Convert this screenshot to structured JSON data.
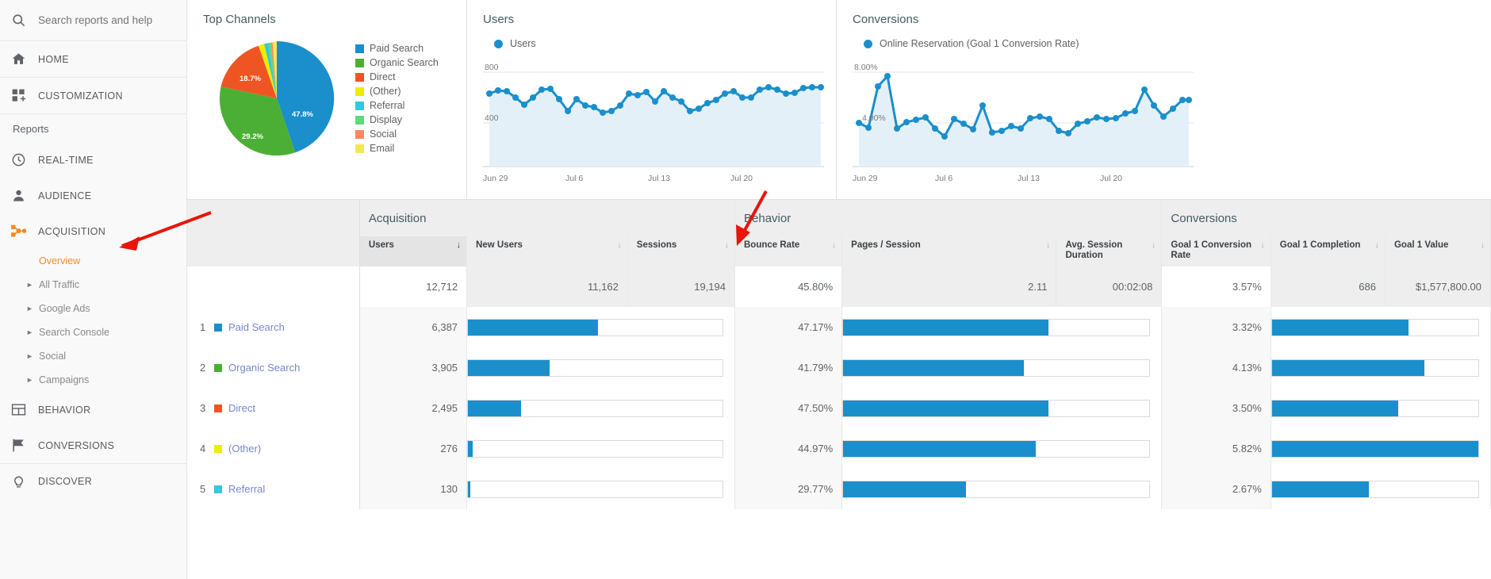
{
  "sidebar": {
    "search": {
      "placeholder": "Search reports and help",
      "icon": "search-icon"
    },
    "home": {
      "label": "HOME",
      "icon": "home-icon"
    },
    "customization": {
      "label": "CUSTOMIZATION",
      "icon": "customization-icon"
    },
    "reports_label": "Reports",
    "items": [
      {
        "label": "REAL-TIME",
        "icon": "clock-icon"
      },
      {
        "label": "AUDIENCE",
        "icon": "person-icon"
      },
      {
        "label": "ACQUISITION",
        "icon": "acquisition-icon"
      },
      {
        "label": "BEHAVIOR",
        "icon": "behavior-icon"
      },
      {
        "label": "CONVERSIONS",
        "icon": "flag-icon"
      },
      {
        "label": "DISCOVER",
        "icon": "lightbulb-icon"
      }
    ],
    "acquisition_sub": [
      {
        "label": "Overview",
        "selected": true
      },
      {
        "label": "All Traffic",
        "selected": false
      },
      {
        "label": "Google Ads",
        "selected": false
      },
      {
        "label": "Search Console",
        "selected": false
      },
      {
        "label": "Social",
        "selected": false
      },
      {
        "label": "Campaigns",
        "selected": false
      }
    ]
  },
  "cards": {
    "pie_title": "Top Channels",
    "users_title": "Users",
    "conversions_title": "Conversions",
    "users_legend": "Users",
    "conversions_legend": "Online Reservation (Goal 1 Conversion Rate)"
  },
  "chart_data": [
    {
      "type": "pie",
      "title": "Top Channels",
      "legend_position": "right",
      "labels": [
        "Paid Search",
        "Organic Search",
        "Direct",
        "(Other)",
        "Referral",
        "Display",
        "Social",
        "Email"
      ],
      "values": [
        47.8,
        29.2,
        18.7,
        1.6,
        1.1,
        0.7,
        0.5,
        0.4
      ],
      "shown_labels": [
        "47.8%",
        "29.2%",
        "18.7%"
      ],
      "colors": [
        "#1a8fcb",
        "#4caf35",
        "#ef5522",
        "#eded00",
        "#36c6e0",
        "#5fd97a",
        "#f98862",
        "#f3e757"
      ]
    },
    {
      "type": "area",
      "title": "Users",
      "series_name": "Users",
      "ylabel": "",
      "xlabel": "",
      "ylim": [
        0,
        1000
      ],
      "yticks": [
        "800",
        "400"
      ],
      "xticks": [
        "Jun 29",
        "Jul 6",
        "Jul 13",
        "Jul 20"
      ],
      "grid": true,
      "values": [
        620,
        640,
        638,
        608,
        572,
        608,
        648,
        650,
        600,
        540,
        600,
        568,
        560,
        530,
        540,
        568,
        620,
        612,
        628,
        578,
        632,
        600,
        578,
        540,
        552,
        580,
        598,
        628,
        640,
        608,
        608,
        648,
        660,
        648,
        628,
        634,
        658,
        660
      ]
    },
    {
      "type": "area",
      "title": "Conversions",
      "series_name": "Online Reservation (Goal 1 Conversion Rate)",
      "ylabel": "",
      "xlabel": "",
      "ylim": [
        0,
        10
      ],
      "yticks": [
        "8.00%",
        "4.00%"
      ],
      "xticks": [
        "Jun 29",
        "Jul 6",
        "Jul 13",
        "Jul 20"
      ],
      "grid": true,
      "values": [
        4.0,
        3.65,
        6.9,
        7.75,
        3.6,
        4.1,
        4.25,
        4.45,
        3.6,
        2.9,
        4.3,
        3.9,
        3.55,
        5.0,
        3.35,
        3.45,
        3.75,
        3.6,
        4.35,
        4.5,
        4.3,
        3.5,
        3.3,
        3.9,
        4.1,
        4.4,
        4.25,
        4.35,
        4.7,
        4.9,
        6.6,
        5.0,
        4.4,
        5.1,
        5.8
      ]
    }
  ],
  "table": {
    "groups": [
      {
        "label": "Acquisition",
        "span": 3
      },
      {
        "label": "Behavior",
        "span": 3
      },
      {
        "label": "Conversions",
        "span": 3
      }
    ],
    "columns": [
      {
        "label": "Users",
        "sorted": true
      },
      {
        "label": "New Users",
        "sorted": false
      },
      {
        "label": "Sessions",
        "sorted": false
      },
      {
        "label": "Bounce Rate",
        "sorted": false
      },
      {
        "label": "Pages / Session",
        "sorted": false
      },
      {
        "label": "Avg. Session Duration",
        "sorted": false
      },
      {
        "label": "Goal 1 Conversion Rate",
        "sorted": false
      },
      {
        "label": "Goal 1 Completion",
        "sorted": false
      },
      {
        "label": "Goal 1 Value",
        "sorted": false
      }
    ],
    "totals": {
      "users": "12,712",
      "new_users": "11,162",
      "sessions": "19,194",
      "bounce_rate": "45.80%",
      "pages_session": "2.11",
      "avg_duration": "00:02:08",
      "goal1_rate": "3.57%",
      "goal1_completion": "686",
      "goal1_value": "$1,577,800.00"
    },
    "rows": [
      {
        "index": "1",
        "name": "Paid Search",
        "color": "#1a8fcb",
        "users": "6,387",
        "new_users_pct": 51,
        "bounce_rate": "47.17%",
        "pages_pct": 67,
        "goal1_rate": "3.32%",
        "goal_pct": 66
      },
      {
        "index": "2",
        "name": "Organic Search",
        "color": "#4caf35",
        "users": "3,905",
        "new_users_pct": 32,
        "bounce_rate": "41.79%",
        "pages_pct": 59,
        "goal1_rate": "4.13%",
        "goal_pct": 74
      },
      {
        "index": "3",
        "name": "Direct",
        "color": "#ef5522",
        "users": "2,495",
        "new_users_pct": 21,
        "bounce_rate": "47.50%",
        "pages_pct": 67,
        "goal1_rate": "3.50%",
        "goal_pct": 61
      },
      {
        "index": "4",
        "name": "(Other)",
        "color": "#eded00",
        "users": "276",
        "new_users_pct": 2,
        "bounce_rate": "44.97%",
        "pages_pct": 63,
        "goal1_rate": "5.82%",
        "goal_pct": 100
      },
      {
        "index": "5",
        "name": "Referral",
        "color": "#36c6e0",
        "users": "130",
        "new_users_pct": 1,
        "bounce_rate": "29.77%",
        "pages_pct": 40,
        "goal1_rate": "2.67%",
        "goal_pct": 47
      }
    ]
  }
}
